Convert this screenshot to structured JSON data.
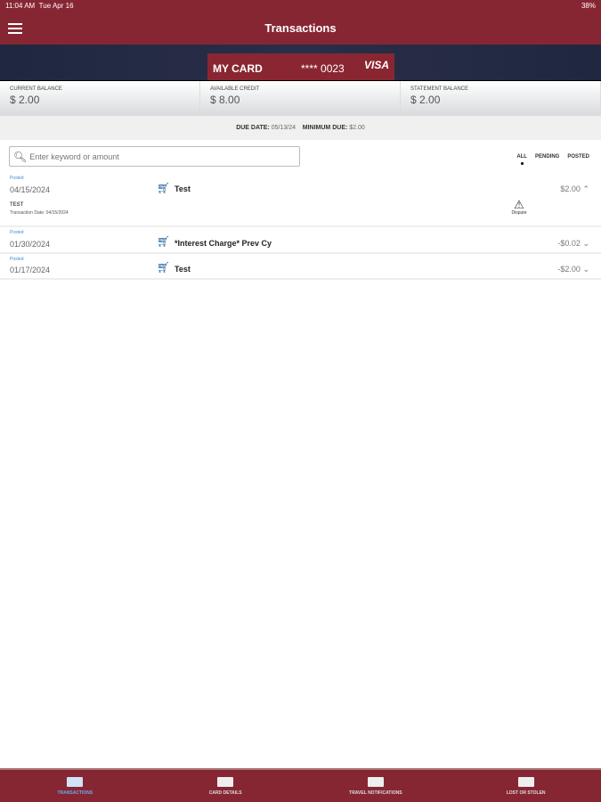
{
  "status": {
    "time": "11:04 AM",
    "date": "Tue Apr 16",
    "battery": "38%"
  },
  "header": {
    "title": "Transactions"
  },
  "card": {
    "name": "MY CARD",
    "number": "**** 0023",
    "brand": "VISA"
  },
  "balances": [
    {
      "label": "Current Balance",
      "value": "$ 2.00"
    },
    {
      "label": "Available Credit",
      "value": "$ 8.00"
    },
    {
      "label": "Statement Balance",
      "value": "$ 2.00"
    }
  ],
  "due": {
    "due_label": "DUE DATE:",
    "due_value": "05/13/24",
    "min_label": "MINIMUM DUE:",
    "min_value": "$2.00"
  },
  "search": {
    "placeholder": "Enter keyword or amount"
  },
  "filters": [
    "ALL",
    "PENDING",
    "POSTED"
  ],
  "transactions": [
    {
      "status": "Posted",
      "date": "04/15/2024",
      "desc": "Test",
      "amount": "$2.00",
      "detail_title": "TEST",
      "detail_date": "Transaction Date: 04/15/2024",
      "dispute": "Dispute"
    },
    {
      "status": "Posted",
      "date": "01/30/2024",
      "desc": "*Interest Charge* Prev Cy",
      "amount": "-$0.02"
    },
    {
      "status": "Posted",
      "date": "01/17/2024",
      "desc": "Test",
      "amount": "-$2.00"
    }
  ],
  "tabs": [
    "Transactions",
    "Card Details",
    "Travel Notifications",
    "Lost or Stolen"
  ]
}
